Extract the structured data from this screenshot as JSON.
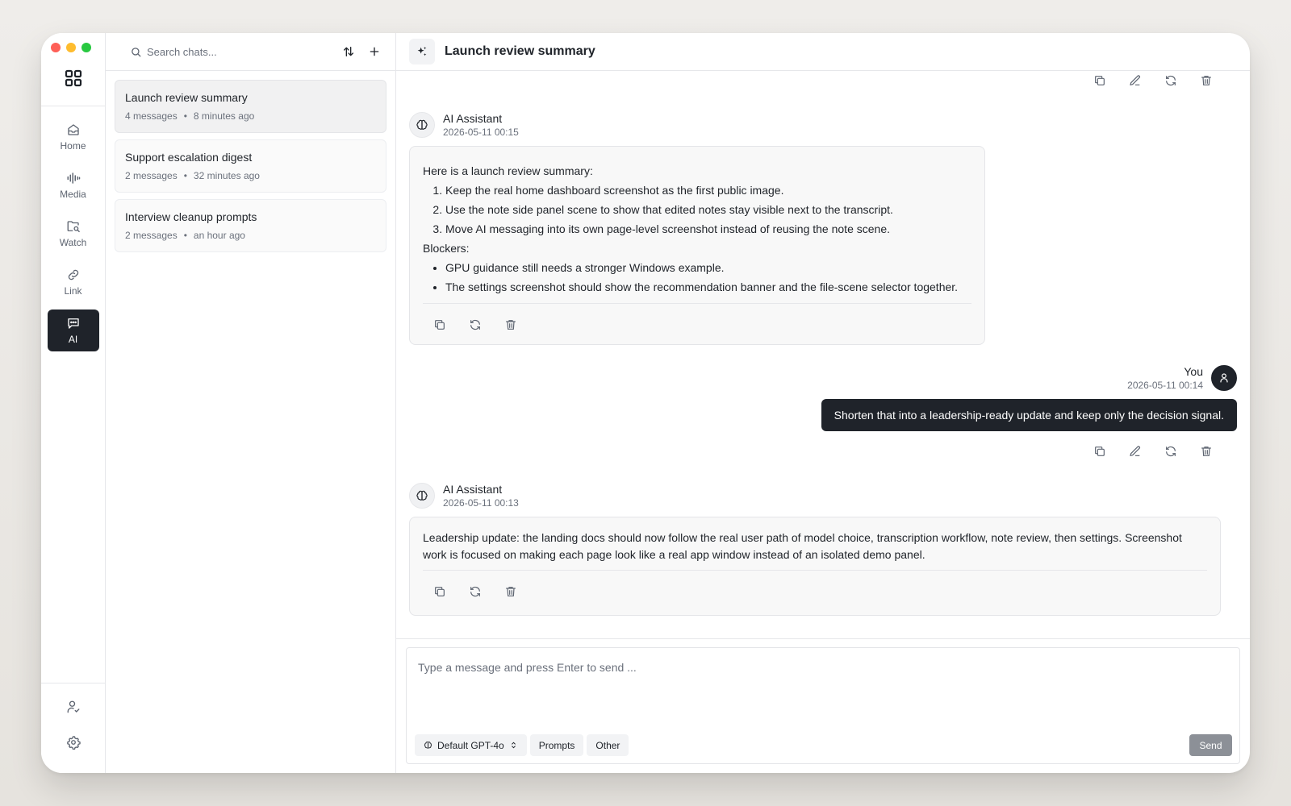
{
  "nav": {
    "items": [
      {
        "label": "Home",
        "icon": "home-icon"
      },
      {
        "label": "Media",
        "icon": "waveform-icon"
      },
      {
        "label": "Watch",
        "icon": "folder-search-icon"
      },
      {
        "label": "Link",
        "icon": "link-icon"
      },
      {
        "label": "AI",
        "icon": "chat-icon",
        "active": true
      }
    ]
  },
  "chat_list": {
    "search_placeholder": "Search chats...",
    "chats": [
      {
        "title": "Launch review summary",
        "count": "4 messages",
        "time": "8 minutes ago",
        "selected": true
      },
      {
        "title": "Support escalation digest",
        "count": "2 messages",
        "time": "32 minutes ago"
      },
      {
        "title": "Interview cleanup prompts",
        "count": "2 messages",
        "time": "an hour ago"
      }
    ]
  },
  "header": {
    "title": "Launch review summary"
  },
  "thread": {
    "assistant_1": {
      "author": "AI Assistant",
      "time": "2026-05-11 00:15",
      "intro": "Here is a launch review summary:",
      "steps": [
        "Keep the real home dashboard screenshot as the first public image.",
        "Use the note side panel scene to show that edited notes stay visible next to the transcript.",
        "Move AI messaging into its own page-level screenshot instead of reusing the note scene."
      ],
      "blockers_label": "Blockers:",
      "blockers": [
        "GPU guidance still needs a stronger Windows example.",
        "The settings screenshot should show the recommendation banner and the file-scene selector together."
      ]
    },
    "user_1": {
      "author": "You",
      "time": "2026-05-11 00:14",
      "text": "Shorten that into a leadership-ready update and keep only the decision signal."
    },
    "assistant_2": {
      "author": "AI Assistant",
      "time": "2026-05-11 00:13",
      "text": "Leadership update: the landing docs should now follow the real user path of model choice, transcription workflow, note review, then settings. Screenshot work is focused on making each page look like a real app window instead of an isolated demo panel."
    }
  },
  "composer": {
    "placeholder": "Type a message and press Enter to send ...",
    "model_label": "Default GPT-4o",
    "prompts_label": "Prompts",
    "other_label": "Other",
    "send_label": "Send"
  },
  "colors": {
    "accent_dark": "#1f232a",
    "send_disabled": "#8c9097"
  }
}
